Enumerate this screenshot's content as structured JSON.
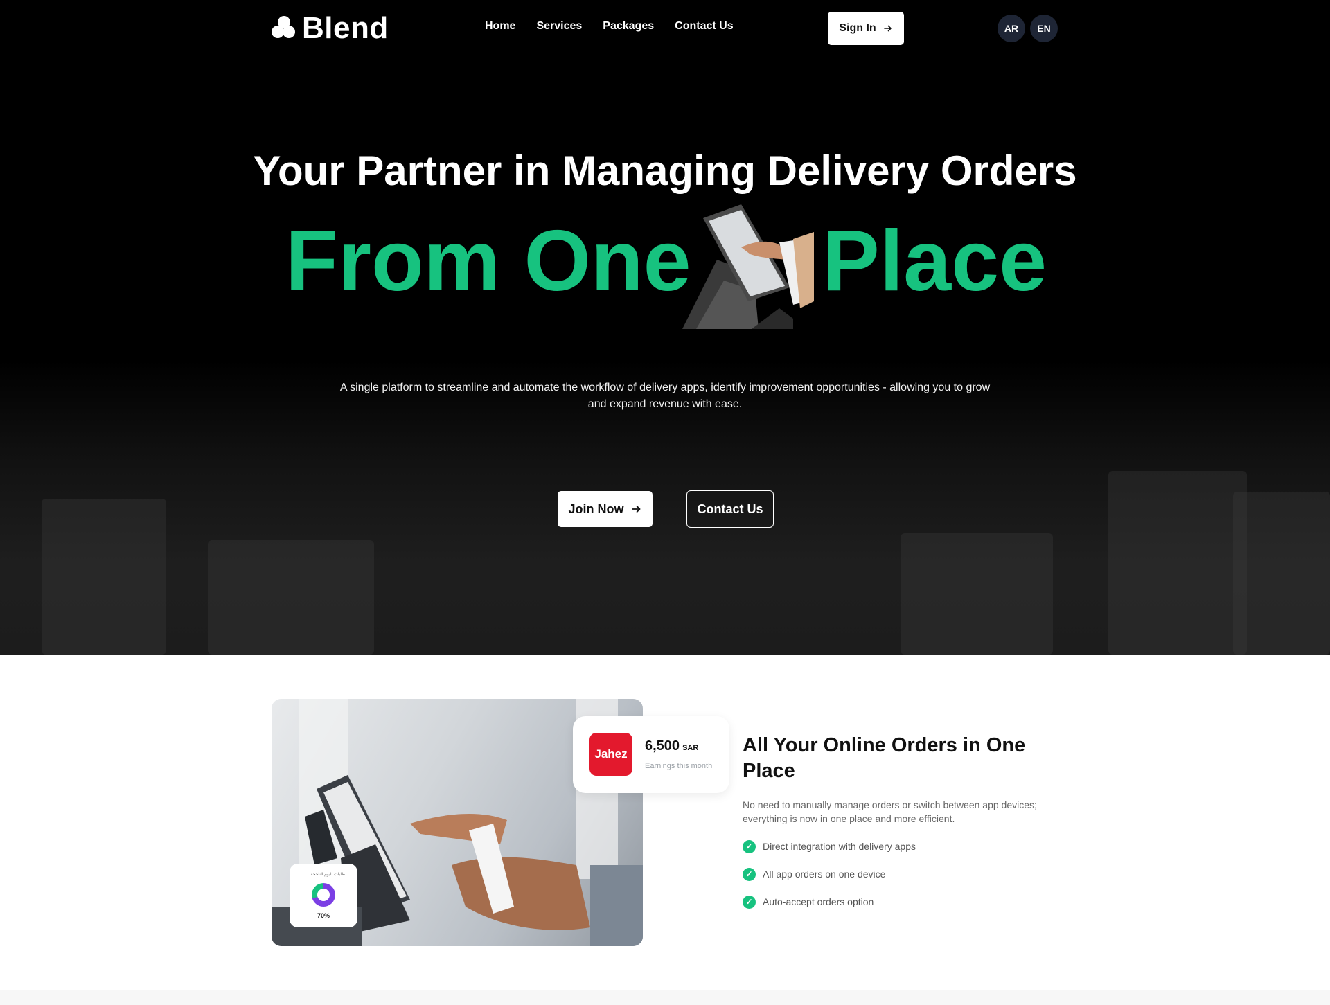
{
  "header": {
    "logo_text": "Blend",
    "nav": [
      "Home",
      "Services",
      "Packages",
      "Contact Us"
    ],
    "sign_in_label": "Sign In",
    "languages": [
      "AR",
      "EN"
    ]
  },
  "hero": {
    "title": "Your Partner in Managing Delivery Orders",
    "highlight_left": "From One",
    "highlight_right": "Place",
    "description": "A single platform to streamline and automate the workflow of delivery apps, identify improvement opportunities - allowing you to grow and expand revenue with ease.",
    "join_label": "Join Now",
    "contact_label": "Contact Us"
  },
  "feature": {
    "earnings_logo": "Jahez",
    "earnings_amount": "6,500",
    "earnings_currency": "SAR",
    "earnings_note": "Earnings this month",
    "donut_label": "طلبات اليوم الناجحة",
    "donut_percent": "70%",
    "donut_value": 0.7,
    "title": "All Your Online Orders in One Place",
    "description": "No need to manually manage orders or switch between app devices; everything is now in one place and more efficient.",
    "checks": [
      "Direct integration with delivery apps",
      "All app orders on one device",
      "Auto-accept orders option"
    ]
  },
  "colors": {
    "accent": "#17c27f",
    "hero_bg": "#000000",
    "jahez_red": "#e3192d",
    "lang_bg": "#1e2535"
  },
  "icons": {
    "arrow": "arrow-right-icon",
    "check": "check-circle-icon",
    "logo": "cloud-logo-icon"
  }
}
